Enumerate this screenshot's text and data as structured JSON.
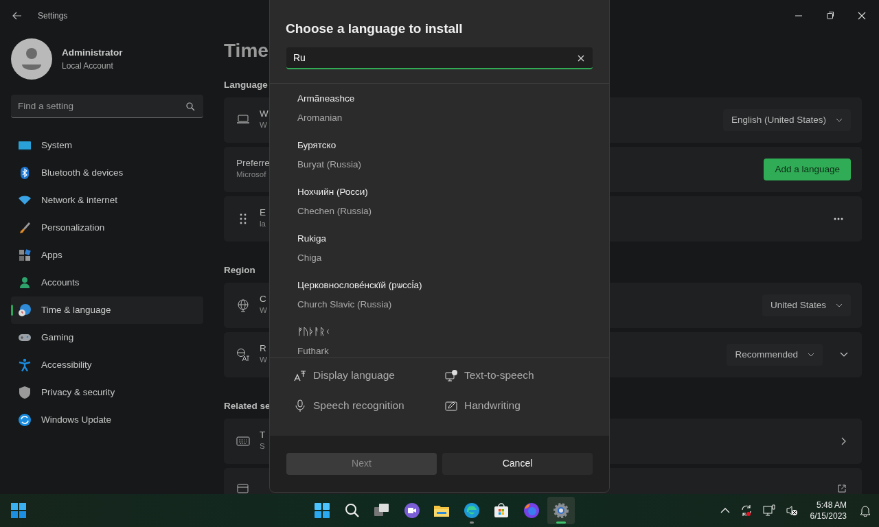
{
  "window": {
    "title": "Settings"
  },
  "account": {
    "name": "Administrator",
    "type": "Local Account"
  },
  "search": {
    "placeholder": "Find a setting"
  },
  "nav": [
    {
      "label": "System",
      "selected": false
    },
    {
      "label": "Bluetooth & devices",
      "selected": false
    },
    {
      "label": "Network & internet",
      "selected": false
    },
    {
      "label": "Personalization",
      "selected": false
    },
    {
      "label": "Apps",
      "selected": false
    },
    {
      "label": "Accounts",
      "selected": false
    },
    {
      "label": "Time & language",
      "selected": true
    },
    {
      "label": "Gaming",
      "selected": false
    },
    {
      "label": "Accessibility",
      "selected": false
    },
    {
      "label": "Privacy & security",
      "selected": false
    },
    {
      "label": "Windows Update",
      "selected": false
    }
  ],
  "page": {
    "heading": "Time",
    "sections": [
      {
        "heading": "Language",
        "cards": [
          {
            "kind": "dropdown",
            "title": "W",
            "subtitle": "W",
            "control": "English (United States)"
          },
          {
            "kind": "button",
            "title": "Preferre",
            "subtitle": "Microsof",
            "control": "Add a language"
          },
          {
            "kind": "more",
            "title": "E",
            "subtitle": "la"
          }
        ]
      },
      {
        "heading": "Region",
        "cards": [
          {
            "kind": "dropdown",
            "title": "C",
            "subtitle": "W",
            "control": "United States"
          },
          {
            "kind": "dropdown-expand",
            "title": "R",
            "subtitle": "W",
            "control": "Recommended"
          }
        ]
      },
      {
        "heading": "Related se",
        "cards": [
          {
            "kind": "link",
            "title": "T",
            "subtitle": "S"
          },
          {
            "kind": "external"
          }
        ]
      }
    ]
  },
  "dialog": {
    "title": "Choose a language to install",
    "search": {
      "value": "Ru"
    },
    "languages": [
      {
        "native": "Armãneashce",
        "english": "Aromanian"
      },
      {
        "native": "Бурятско",
        "english": "Buryat (Russia)"
      },
      {
        "native": "Нохчийн (Росси)",
        "english": "Chechen (Russia)"
      },
      {
        "native": "Rukiga",
        "english": "Chiga"
      },
      {
        "native": "Церковнослове́нскїй (рѡссі́а)",
        "english": "Church Slavic (Russia)"
      },
      {
        "native": "ᚠᚢᚦᚨᚱᚲ",
        "english": "Futhark"
      }
    ],
    "features": [
      {
        "label": "Display language"
      },
      {
        "label": "Text-to-speech"
      },
      {
        "label": "Speech recognition"
      },
      {
        "label": "Handwriting"
      }
    ],
    "buttons": [
      {
        "label": "Next",
        "disabled": true
      },
      {
        "label": "Cancel",
        "disabled": false
      }
    ]
  },
  "taskbar": {
    "apps": [
      {
        "running": false,
        "active": false
      },
      {
        "running": false,
        "active": false
      },
      {
        "running": false,
        "active": false
      },
      {
        "running": false,
        "active": false
      },
      {
        "running": false,
        "active": false
      },
      {
        "running": true,
        "active": false
      },
      {
        "running": false,
        "active": false
      },
      {
        "running": false,
        "active": false
      },
      {
        "running": true,
        "active": true
      }
    ],
    "clock": {
      "time": "5:48 AM",
      "date": "6/15/2023"
    }
  }
}
